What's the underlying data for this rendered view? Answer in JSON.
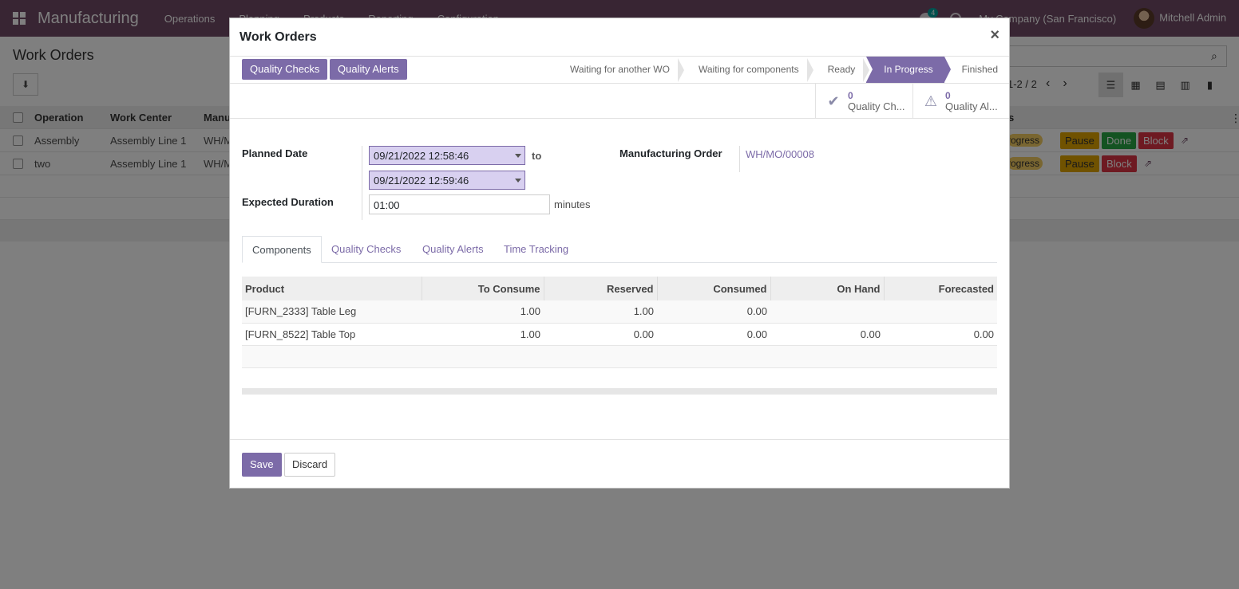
{
  "navbar": {
    "brand": "Manufacturing",
    "menu": [
      "Operations",
      "Planning",
      "Products",
      "Reporting",
      "Configuration"
    ],
    "chat_count": "4",
    "company": "My Company (San Francisco)",
    "user": "Mitchell Admin"
  },
  "background": {
    "title": "Work Orders",
    "pager": "1-2 / 2",
    "columns": [
      "Operation",
      "Work Center",
      "Manu",
      "s"
    ],
    "rows": [
      {
        "operation": "Assembly",
        "work_center": "Assembly Line 1",
        "mo": "WH/M",
        "status": "rogress",
        "buttons": [
          "Pause",
          "Done",
          "Block"
        ]
      },
      {
        "operation": "two",
        "work_center": "Assembly Line 1",
        "mo": "WH/M",
        "status": "rogress",
        "buttons": [
          "Pause",
          "Block"
        ]
      }
    ]
  },
  "modal": {
    "title": "Work Orders",
    "close": "×",
    "header_buttons": {
      "quality_checks": "Quality Checks",
      "quality_alerts": "Quality Alerts"
    },
    "stages": [
      "Waiting for another WO",
      "Waiting for components",
      "Ready",
      "In Progress",
      "Finished"
    ],
    "active_stage": "In Progress",
    "smart_buttons": [
      {
        "value": "0",
        "label": "Quality Ch..."
      },
      {
        "value": "0",
        "label": "Quality Al..."
      }
    ],
    "form": {
      "planned_date_label": "Planned Date",
      "date_start": "09/21/2022 12:58:46",
      "to_label": "to",
      "date_end": "09/21/2022 12:59:46",
      "expected_duration_label": "Expected Duration",
      "duration": "01:00",
      "duration_unit": "minutes",
      "mo_label": "Manufacturing Order",
      "mo_value": "WH/MO/00008"
    },
    "tabs": [
      "Components",
      "Quality Checks",
      "Quality Alerts",
      "Time Tracking"
    ],
    "components": {
      "headers": [
        "Product",
        "To Consume",
        "Reserved",
        "Consumed",
        "On Hand",
        "Forecasted"
      ],
      "rows": [
        {
          "product": "[FURN_2333] Table Leg",
          "to_consume": "1.00",
          "reserved": "1.00",
          "consumed": "0.00",
          "on_hand": "",
          "forecasted": ""
        },
        {
          "product": "[FURN_8522] Table Top",
          "to_consume": "1.00",
          "reserved": "0.00",
          "consumed": "0.00",
          "on_hand": "0.00",
          "forecasted": "0.00"
        }
      ]
    },
    "footer": {
      "save": "Save",
      "discard": "Discard"
    }
  }
}
